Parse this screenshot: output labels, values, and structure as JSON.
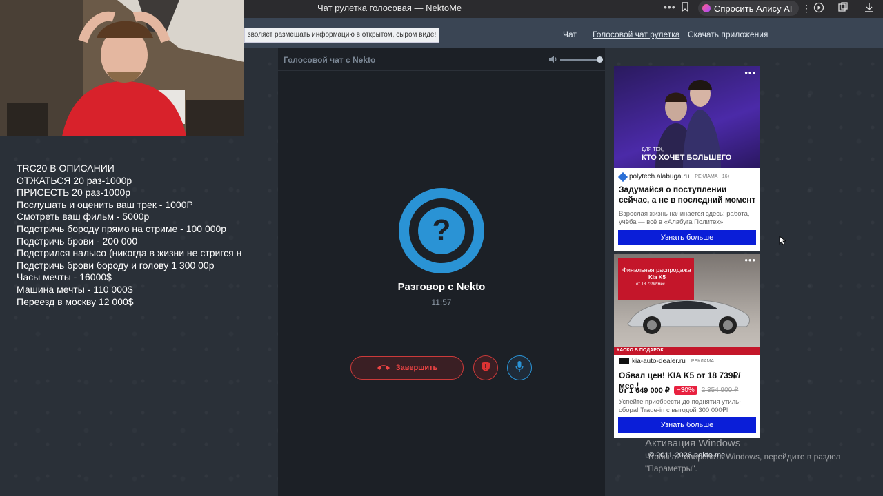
{
  "browser": {
    "tab_title": "Чат рулетка голосовая — NektoMe",
    "alice_label": "Спросить Алису AI"
  },
  "site": {
    "notice": "зволяет размещать информацию в открытом, сыром виде!",
    "nav": [
      "Чат",
      "Голосовой чат рулетка",
      "Скачать приложения"
    ]
  },
  "chat": {
    "header": "Голосовой чат с Nekto",
    "avatar_symbol": "?",
    "peer_name": "Разговор с Nekto",
    "timer": "11:57",
    "end_label": "Завершить",
    "volume_level": 1.0
  },
  "overlay": {
    "donations": [
      "TRC20 В ОПИСАНИИ",
      "ОТЖАТЬСЯ 20 раз-1000р",
      "ПРИСЕСТЬ 20 раз-1000р",
      "Послушать и оценить ваш трек - 1000Р",
      "Смотреть ваш фильм - 5000р",
      "Подстричь бороду прямо на стриме - 100 000р",
      "Подстричь брови - 200 000",
      "Подстрился налысо (никогда в жизни не стригся н",
      "Подстричь брови бороду и голову 1 300 00р",
      "Часы мечты - 16000$",
      "Машина мечты - 110 000$",
      "Переезд в москву 12 000$"
    ]
  },
  "ads": [
    {
      "image_caption_small": "ДЛЯ ТЕХ,",
      "image_caption": "КТО ХОЧЕТ БОЛЬШЕГО",
      "domain": "polytech.alabuga.ru",
      "tag": "РЕКЛАМА · 16+",
      "headline": "Задумайся о поступлении сейчас, а не в последний момент",
      "text": "Взрослая жизнь начинается здесь: работа, учёба — всё в «Алабуга Политех»",
      "button": "Узнать больше"
    },
    {
      "image_caption": "Финальная распродажа",
      "image_model": "Kia K5",
      "image_price": "от 18 739₽/мес.",
      "image_strip": "КАСКО В ПОДАРОК",
      "domain": "kia-auto-dealer.ru",
      "tag": "РЕКЛАМА",
      "headline": "Обвал цен! KIA K5 от 18 739₽/мес.!",
      "price": "от 1 649 000 ₽",
      "discount": "−30%",
      "old_price": "2 354 900 ₽",
      "text": "Успейте приобрести до поднятия утиль-сбора! Trade-in с выгодой 300 000₽!",
      "button": "Узнать больше"
    }
  ],
  "windows": {
    "activation_title": "Активация Windows",
    "activation_text": "Чтобы активировать Windows, перейдите в раздел \"Параметры\"."
  },
  "footer": {
    "copyright": "© 2011-2026 nekto.me"
  }
}
